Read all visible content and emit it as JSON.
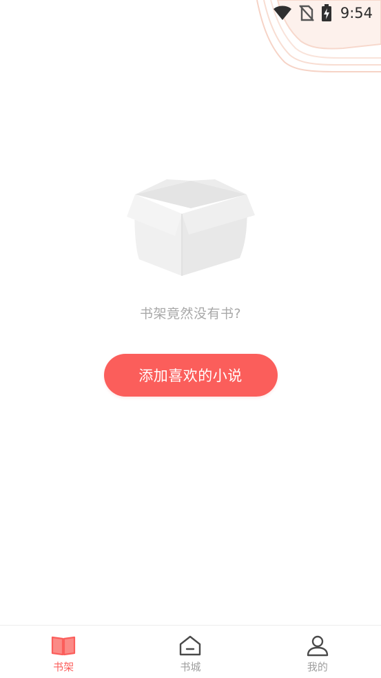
{
  "status_bar": {
    "time": "9:54",
    "icons": [
      "wifi-icon",
      "no-sim-icon",
      "battery-charging-icon"
    ]
  },
  "empty_state": {
    "illustration": "empty-box-icon",
    "message": "书架竟然没有书?",
    "button_label": "添加喜欢的小说"
  },
  "tab_bar": {
    "tabs": [
      {
        "label": "书架",
        "icon": "open-book-icon",
        "active": true
      },
      {
        "label": "书城",
        "icon": "home-icon",
        "active": false
      },
      {
        "label": "我的",
        "icon": "user-icon",
        "active": false
      }
    ]
  },
  "colors": {
    "accent": "#fb5e5b",
    "inactive": "#9e9e9e",
    "muted_text": "#a8a8a8"
  }
}
